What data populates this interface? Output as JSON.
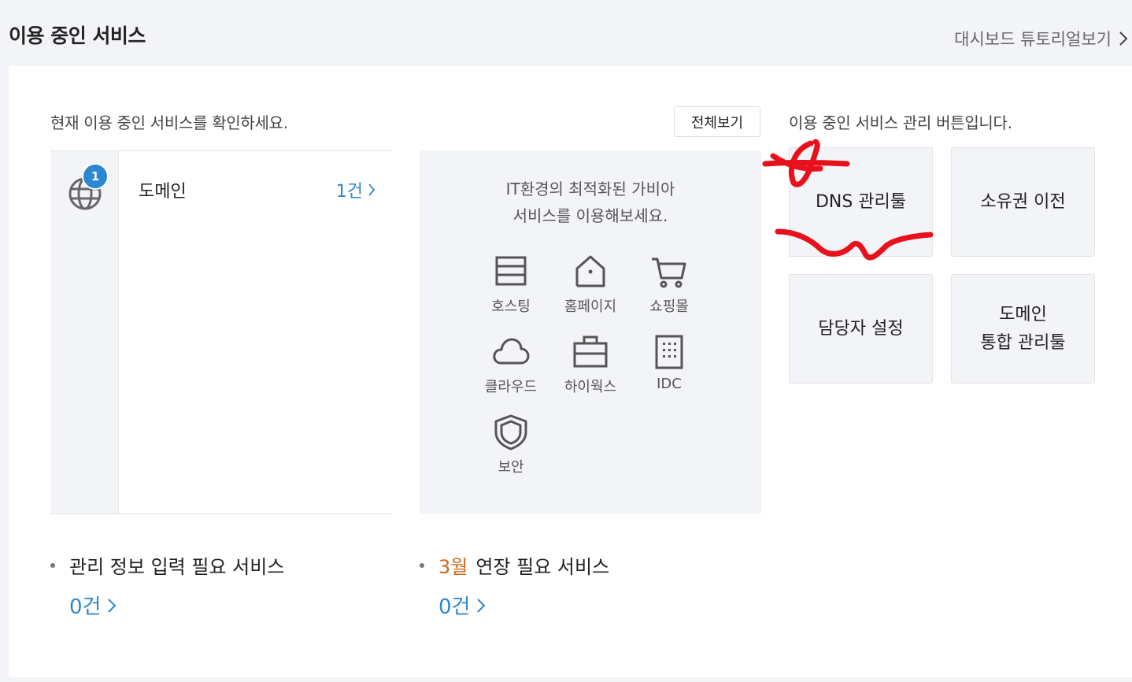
{
  "header": {
    "title": "이용 중인 서비스",
    "tutorial_link": "대시보드 튜토리얼보기"
  },
  "main": {
    "intro": "현재 이용 중인 서비스를 확인하세요.",
    "view_all_label": "전체보기",
    "services": [
      {
        "name": "도메인",
        "badge": "1",
        "count": "1건",
        "icon": "globe-icon"
      }
    ],
    "promo": {
      "line1": "IT환경의 최적화된 가비아",
      "line2": "서비스를 이용해보세요.",
      "items": [
        {
          "label": "호스팅",
          "icon": "server-icon"
        },
        {
          "label": "홈페이지",
          "icon": "home-icon"
        },
        {
          "label": "쇼핑몰",
          "icon": "cart-icon"
        },
        {
          "label": "클라우드",
          "icon": "cloud-icon"
        },
        {
          "label": "하이웍스",
          "icon": "briefcase-icon"
        },
        {
          "label": "IDC",
          "icon": "building-icon"
        },
        {
          "label": "보안",
          "icon": "shield-icon"
        }
      ]
    }
  },
  "management": {
    "intro": "이용 중인 서비스 관리 버튼입니다.",
    "buttons": {
      "dns": "DNS 관리툴",
      "ownership": "소유권 이전",
      "contact": "담당자 설정",
      "domain_line1": "도메인",
      "domain_line2": "통합 관리툴"
    }
  },
  "bottom": {
    "admin_info": {
      "label": "관리 정보 입력 필요 서비스",
      "count": "0건"
    },
    "renewal": {
      "month": "3월",
      "label": "연장 필요 서비스",
      "count": "0건"
    }
  },
  "colors": {
    "accent": "#2c87d0",
    "month": "#c96a1a",
    "annotation": "#e8101c"
  }
}
